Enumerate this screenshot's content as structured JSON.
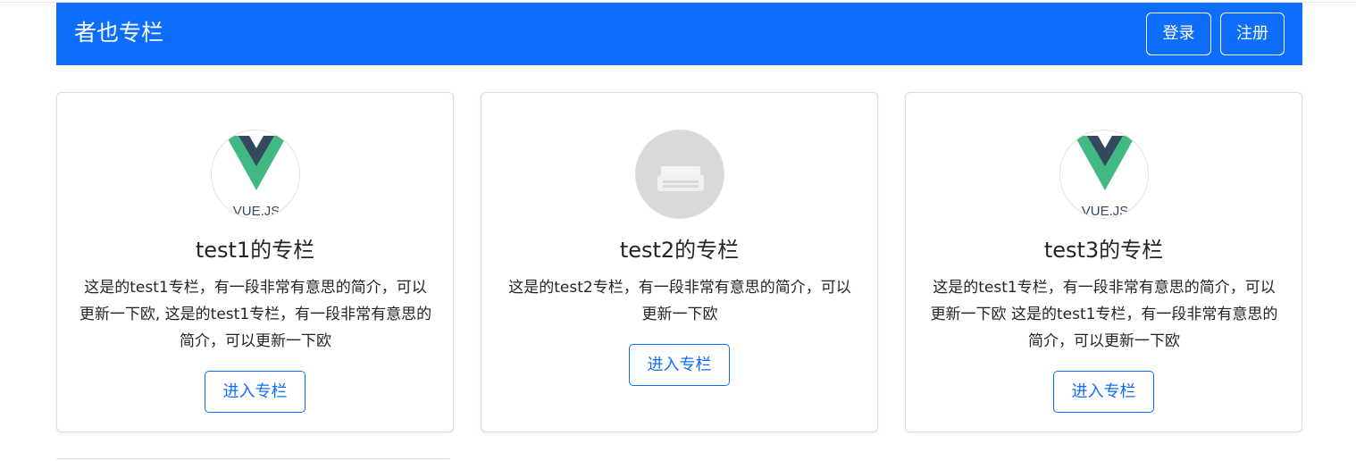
{
  "navbar": {
    "brand": "者也专栏",
    "login_label": "登录",
    "register_label": "注册",
    "color": "#0d6efd"
  },
  "columns": [
    {
      "title": "test1的专栏",
      "description": "这是的test1专栏，有一段非常有意思的简介，可以更新一下欧, 这是的test1专栏，有一段非常有意思的简介，可以更新一下欧",
      "avatar_icon": "vue-logo-icon",
      "avatar_caption": "VUE.JS",
      "button_label": "进入专栏"
    },
    {
      "title": "test2的专栏",
      "description": "这是的test2专栏，有一段非常有意思的简介，可以更新一下欧",
      "avatar_icon": "typewriter-icon",
      "button_label": "进入专栏"
    },
    {
      "title": "test3的专栏",
      "description": "这是的test1专栏，有一段非常有意思的简介，可以更新一下欧 这是的test1专栏，有一段非常有意思的简介，可以更新一下欧",
      "avatar_icon": "vue-logo-icon",
      "avatar_caption": "VUE.JS",
      "button_label": "进入专栏"
    }
  ]
}
